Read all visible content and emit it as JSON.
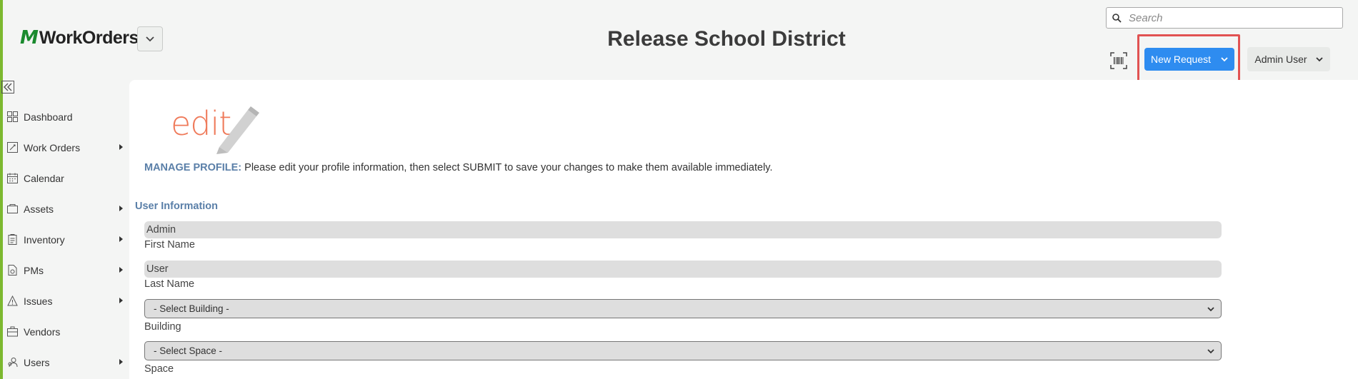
{
  "header": {
    "logo_mark": "M",
    "logo_text": "WorkOrders",
    "title": "Release School District",
    "search_placeholder": "Search",
    "new_request_label": "New Request",
    "user_label": "Admin User"
  },
  "sidebar": {
    "items": [
      {
        "label": "Dashboard",
        "icon": "dashboard-icon",
        "has_submenu": false
      },
      {
        "label": "Work Orders",
        "icon": "work-orders-icon",
        "has_submenu": true
      },
      {
        "label": "Calendar",
        "icon": "calendar-icon",
        "has_submenu": false
      },
      {
        "label": "Assets",
        "icon": "assets-icon",
        "has_submenu": true
      },
      {
        "label": "Inventory",
        "icon": "inventory-icon",
        "has_submenu": true
      },
      {
        "label": "PMs",
        "icon": "pms-icon",
        "has_submenu": true
      },
      {
        "label": "Issues",
        "icon": "issues-icon",
        "has_submenu": true
      },
      {
        "label": "Vendors",
        "icon": "vendors-icon",
        "has_submenu": false
      },
      {
        "label": "Users",
        "icon": "users-icon",
        "has_submenu": true
      }
    ]
  },
  "main": {
    "edit_logo_text": "edit",
    "manage_label": "MANAGE PROFILE:",
    "manage_text": " Please edit your profile information, then select SUBMIT to save your changes to make them available immediately.",
    "section_title": "User Information",
    "first_name_value": "Admin",
    "first_name_label": "First Name",
    "last_name_value": "User",
    "last_name_label": "Last Name",
    "building_value": "- Select Building -",
    "building_label": "Building",
    "space_value": "- Select Space -",
    "space_label": "Space"
  },
  "colors": {
    "accent_green": "#7cb82f",
    "primary_blue": "#2e8cf0",
    "highlight_red": "#e15252",
    "label_blue": "#5a7fa8"
  }
}
